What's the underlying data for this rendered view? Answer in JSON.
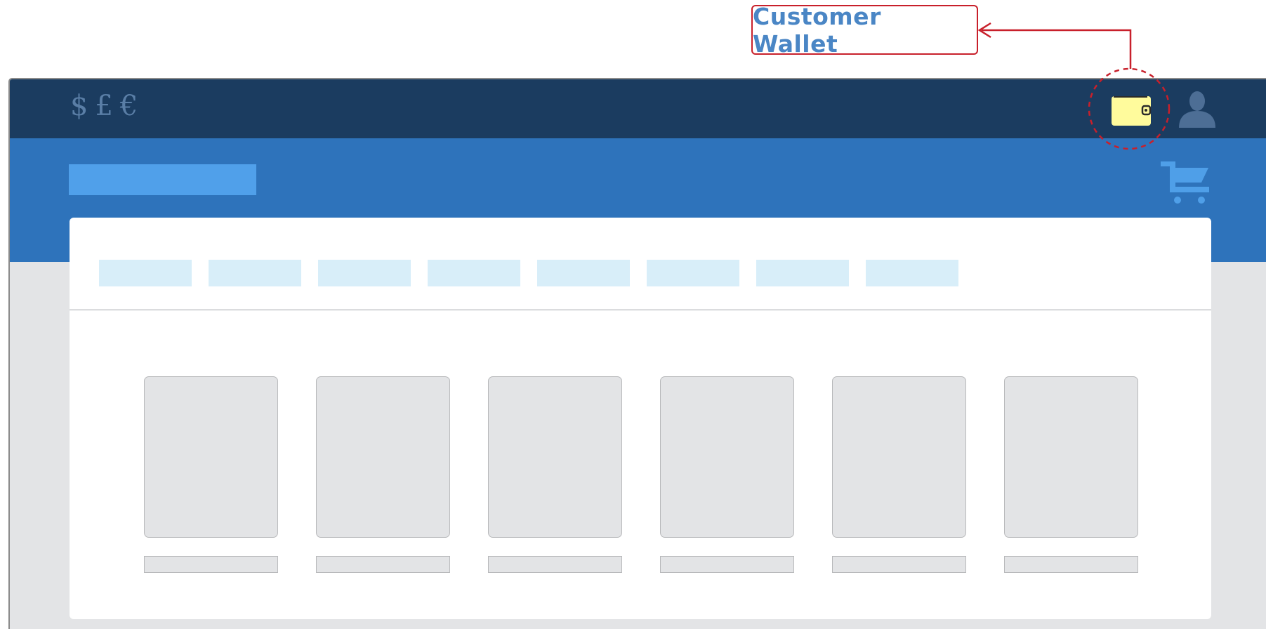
{
  "annotation": {
    "label": "Customer  Wallet",
    "color": "#c8202b",
    "text_color": "#4a86c5"
  },
  "topbar": {
    "currencies": [
      "$",
      "£",
      "€"
    ],
    "icons": {
      "wallet": "wallet-icon",
      "user": "user-icon"
    },
    "background": "#1b3c60",
    "wallet_color": "#fffb9c"
  },
  "header": {
    "background": "#2e73bb",
    "logo_placeholder_color": "#50a0ea",
    "cart_icon": "shopping-cart-icon"
  },
  "nav": {
    "tab_count": 8,
    "tab_color": "#d8eef9"
  },
  "products": {
    "count": 6,
    "placeholder_color": "#e3e4e6"
  }
}
